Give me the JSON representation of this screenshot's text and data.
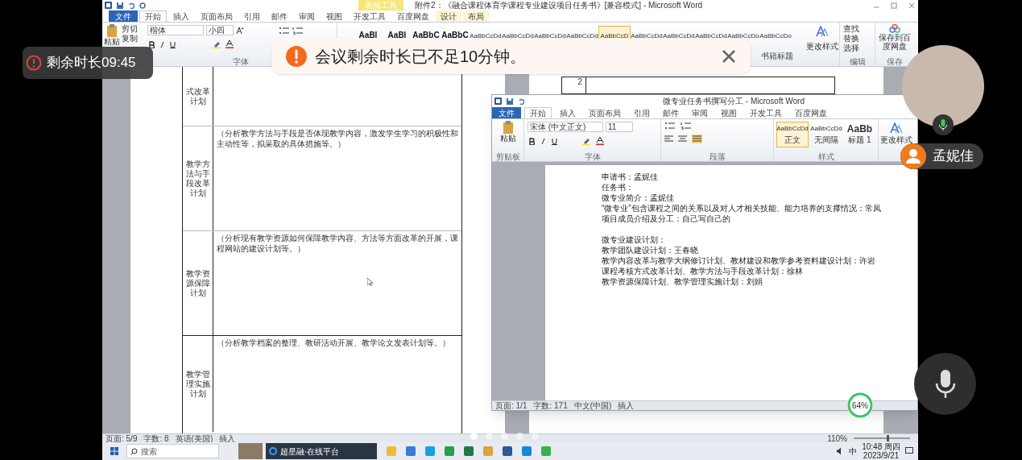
{
  "meeting": {
    "timer": "剩余时长09:45",
    "toast": {
      "text": "会议剩余时长已不足10分钟。"
    },
    "participant": {
      "name": "孟妮佳",
      "mic_on": true
    },
    "pager": [
      {
        "selected": true
      },
      {
        "selected": false
      },
      {
        "selected": false
      },
      {
        "selected": false
      },
      {
        "selected": false
      }
    ],
    "gauge": {
      "label": "64%"
    }
  },
  "back_window": {
    "title": "附件2：《融合课程体育学课程专业建设项目任务书》[兼容模式] - Microsoft Word",
    "context_header": "表格工具",
    "tabs": [
      {
        "label": "文件",
        "kind": "file",
        "selected": false
      },
      {
        "label": "开始",
        "kind": "tab",
        "selected": true
      },
      {
        "label": "插入",
        "kind": "tab",
        "selected": false
      },
      {
        "label": "页面布局",
        "kind": "tab",
        "selected": false
      },
      {
        "label": "引用",
        "kind": "tab",
        "selected": false
      },
      {
        "label": "邮件",
        "kind": "tab",
        "selected": false
      },
      {
        "label": "审阅",
        "kind": "tab",
        "selected": false
      },
      {
        "label": "视图",
        "kind": "tab",
        "selected": false
      },
      {
        "label": "开发工具",
        "kind": "tab",
        "selected": false
      },
      {
        "label": "百度网盘",
        "kind": "tab",
        "selected": false
      },
      {
        "label": "设计",
        "kind": "context",
        "selected": false
      },
      {
        "label": "布局",
        "kind": "context",
        "selected": false
      }
    ],
    "ribbon": {
      "clipboard": [
        "粘贴",
        "剪切",
        "复制"
      ],
      "font": "楷体",
      "size": "小四",
      "font_group": "字体",
      "styles": [
        {
          "sample": "AaBl",
          "selected": false
        },
        {
          "sample": "AaBl",
          "selected": false
        },
        {
          "sample": "AaBbC",
          "selected": false
        },
        {
          "sample": "AaBbC",
          "selected": false
        },
        {
          "sample": "AaBbCcDd",
          "selected": false
        },
        {
          "sample": "AaBbCcDd",
          "selected": false
        },
        {
          "sample": "AaBbCcDd",
          "selected": false
        },
        {
          "sample": "AaBbCcDd",
          "selected": false
        },
        {
          "sample": "AaBbCcD",
          "selected": true
        },
        {
          "sample": "AaBbCcDd",
          "selected": false
        },
        {
          "sample": "AaBbCcDd",
          "selected": false
        },
        {
          "sample": "AaBbCcDd",
          "selected": false
        },
        {
          "sample": "AaBbCcDo",
          "selected": false
        },
        {
          "sample": "AaBbCcDo",
          "selected": false
        }
      ],
      "style_labels": [
        "书籍标题"
      ],
      "change_styles": "更改样式",
      "edit": [
        "查找",
        "替换",
        "选择"
      ],
      "edit_group": "编辑",
      "save": "保存到百度网盘",
      "save_group": "保存"
    },
    "table_rows": [
      {
        "label": "式改革计划",
        "text": ""
      },
      {
        "label": "教学方法与手段改革计划",
        "text": "（分析教学方法与手段是否体现教学内容，激发学生学习的积极性和主动性等，拟采取的具体措施等。）"
      },
      {
        "label": "教学资源保障计划",
        "text": "（分析现有教学资源如何保障教学内容、方法等方面改革的开展，课程网站的建设计划等。）"
      },
      {
        "label": "教学管理实施计划",
        "text": "（分析教学档案的整理、教研活动开展、教学论文发表计划等。）"
      }
    ],
    "right_page_cells": [
      "2"
    ],
    "status_bar": [
      "页面: 5/9",
      "字数: 8",
      "英语(美国)",
      "插入"
    ],
    "zoom": "110%",
    "zoom_slider": {
      "level": 0.58
    }
  },
  "front_window": {
    "title": "微专业任务书撰写分工 - Microsoft Word",
    "tabs": [
      {
        "label": "文件",
        "kind": "file",
        "selected": false
      },
      {
        "label": "开始",
        "kind": "tab",
        "selected": true
      },
      {
        "label": "插入",
        "kind": "tab",
        "selected": false
      },
      {
        "label": "页面布局",
        "kind": "tab",
        "selected": false
      },
      {
        "label": "引用",
        "kind": "tab",
        "selected": false
      },
      {
        "label": "邮件",
        "kind": "tab",
        "selected": false
      },
      {
        "label": "审阅",
        "kind": "tab",
        "selected": false
      },
      {
        "label": "视图",
        "kind": "tab",
        "selected": false
      },
      {
        "label": "开发工具",
        "kind": "tab",
        "selected": false
      },
      {
        "label": "百度网盘",
        "kind": "tab",
        "selected": false
      }
    ],
    "ribbon": {
      "paste": "粘贴",
      "font": "宋体 (中文正文)",
      "size": "11",
      "groups": [
        "剪贴板",
        "字体",
        "段落",
        "样式"
      ],
      "styles": [
        {
          "sample": "AaBbCcDd",
          "label": "正文",
          "selected": true
        },
        {
          "sample": "AaBbCcDd",
          "label": "无间隔",
          "selected": false
        },
        {
          "sample": "AaBb",
          "label": "标题 1",
          "selected": false
        }
      ],
      "change_styles": "更改样式"
    },
    "lines": [
      "申请书：孟妮佳",
      "任务书：",
      "微专业简介：孟妮佳",
      "“微专业”包含课程之间的关系以及对人才相关技能、能力培养的支撑情况：常凤",
      "项目成员介绍及分工：自己写自己的"
    ],
    "lines_after_gap": [
      "微专业建设计划：",
      "教学团队建设计划：王春晓",
      "教学内容改革与教学大纲修订计划、教材建设和教学参考资料建设计划：许岩",
      "课程考核方式改革计划、教学方法与手段改革计划：徐林",
      "教学资源保障计划、教学管理实施计划：刘娟"
    ],
    "status_bar": [
      "页面: 1/1",
      "字数: 171",
      "中文(中国)",
      "插入"
    ]
  },
  "taskbar": {
    "search": "搜索",
    "browser_tab": "超星融·在线平台",
    "ime": "中",
    "time": "10:48 周四",
    "date": "2023/9/21"
  }
}
